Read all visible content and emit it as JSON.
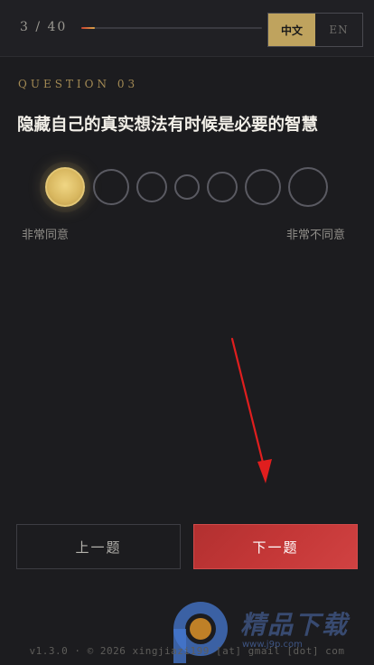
{
  "header": {
    "counter": "3 / 40",
    "progress": 0.075,
    "lang_zh": "中文",
    "lang_en": "EN",
    "active_lang": "zh"
  },
  "question": {
    "label": "QUESTION 03",
    "text": "隐藏自己的真实想法有时候是必要的智慧"
  },
  "scale": {
    "options": 7,
    "selected": 1,
    "left_label": "非常同意",
    "right_label": "非常不同意"
  },
  "nav": {
    "prev_label": "上一题",
    "next_label": "下一题"
  },
  "footer": {
    "text": "v1.3.0 · © 2026 xingjiazi199 [at] gmail [dot] com"
  },
  "watermark": {
    "text": "精品下载",
    "url": "www.j9p.com"
  },
  "colors": {
    "accent_gold": "#bfa35e",
    "accent_red": "#c43737",
    "annotation_arrow": "#e01e1e"
  },
  "icons": {
    "annotation": "arrow-down-icon",
    "watermark_logo": "p-logo-icon"
  }
}
